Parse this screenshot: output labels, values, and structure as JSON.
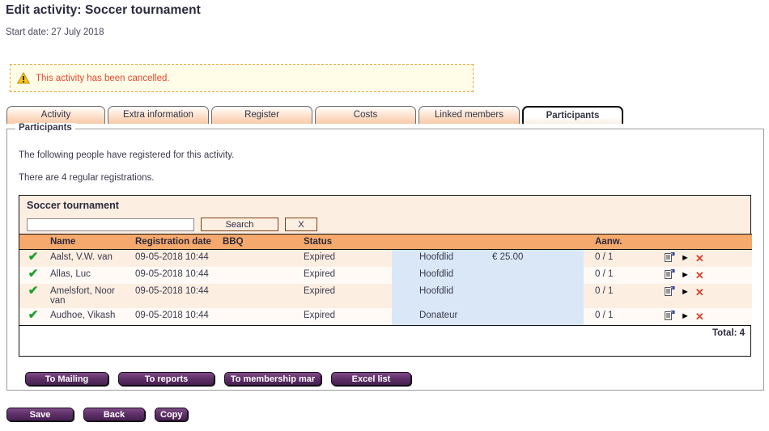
{
  "header": {
    "title": "Edit activity: Soccer tournament",
    "start_date": "Start date: 27 July 2018"
  },
  "warning": {
    "icon": "warning-triangle-icon",
    "text": "This activity has been cancelled."
  },
  "tabs": [
    {
      "label": "Activity",
      "active": false
    },
    {
      "label": "Extra information",
      "active": false
    },
    {
      "label": "Register",
      "active": false
    },
    {
      "label": "Costs",
      "active": false
    },
    {
      "label": "Linked members",
      "active": false
    },
    {
      "label": "Participants",
      "active": true
    }
  ],
  "fieldset": {
    "legend": "Participants",
    "paragraph_1": "The following people have registered for this activity.",
    "paragraph_2": "There are 4 regular registrations."
  },
  "panel": {
    "title": "Soccer tournament",
    "search": {
      "value": "",
      "placeholder": "",
      "search_label": "Search",
      "clear_label": "X"
    },
    "columns": {
      "check": "",
      "name": "Name",
      "registration_date": "Registration date",
      "bbq": "BBQ",
      "status": "Status",
      "type": "",
      "amount": "",
      "aanw": "Aanw.",
      "actions": ""
    },
    "rows": [
      {
        "check": "✔",
        "name": "Aalst, V.W. van",
        "registration_date": "09-05-2018 10:44",
        "bbq": "",
        "status": "Expired",
        "type": "Hoofdlid",
        "amount": "€ 25.00",
        "aanw": "0 / 1",
        "actions": [
          "properties-icon",
          "play-icon",
          "delete-icon"
        ]
      },
      {
        "check": "✔",
        "name": "Allas, Luc",
        "registration_date": "09-05-2018 10:44",
        "bbq": "",
        "status": "Expired",
        "type": "Hoofdlid",
        "amount": "",
        "aanw": "0 / 1",
        "actions": [
          "properties-icon",
          "play-icon",
          "delete-icon"
        ]
      },
      {
        "check": "✔",
        "name": "Amelsfort, Noor van",
        "registration_date": "09-05-2018 10:44",
        "bbq": "",
        "status": "Expired",
        "type": "Hoofdlid",
        "amount": "",
        "aanw": "0 / 1",
        "actions": [
          "properties-icon",
          "play-icon",
          "delete-icon"
        ]
      },
      {
        "check": "✔",
        "name": "Audhoe, Vikash",
        "registration_date": "09-05-2018 10:44",
        "bbq": "",
        "status": "Expired",
        "type": "Donateur",
        "amount": "",
        "aanw": "0 / 1",
        "actions": [
          "properties-icon",
          "play-icon",
          "delete-icon"
        ]
      }
    ],
    "total": "Total: 4"
  },
  "panel_buttons": [
    {
      "label": "To Mailing"
    },
    {
      "label": "To reports"
    },
    {
      "label": "To membership mar"
    },
    {
      "label": "Excel list"
    }
  ],
  "page_buttons": [
    {
      "label": "Save"
    },
    {
      "label": "Back"
    },
    {
      "label": "Copy"
    }
  ],
  "colors": {
    "tab_gradient_start": "#ffffff",
    "tab_gradient_end": "#f8c9a8",
    "table_header": "#f6a96c",
    "row_odd": "#fdeee2",
    "row_even": "#fffaf6",
    "highlight_column": "#d9e7f7",
    "warning_bg": "#fffde8",
    "warning_border": "#e8a33d",
    "warning_text": "#e8462b",
    "button_purple": "#5d2f66",
    "check_green": "#1a9f2a",
    "delete_red": "#d7442c"
  }
}
